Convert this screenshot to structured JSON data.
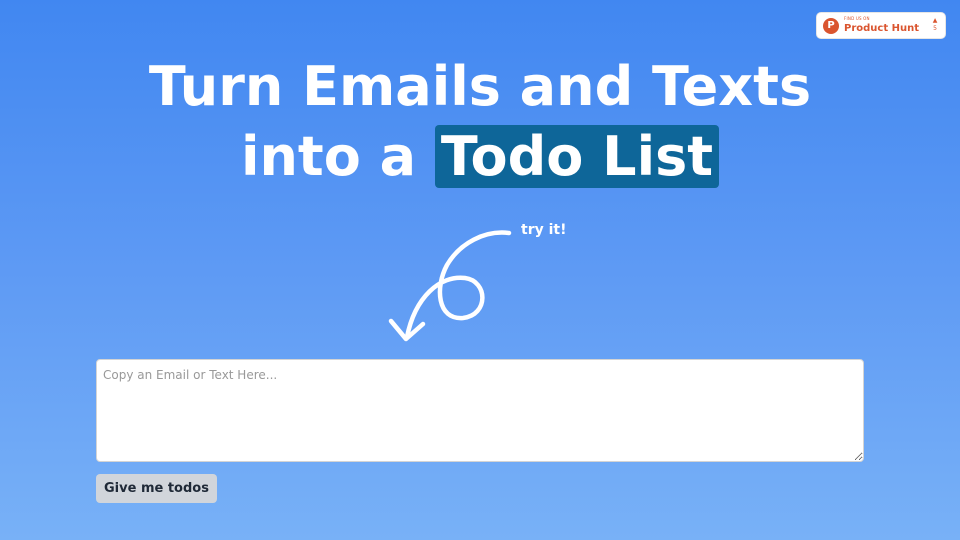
{
  "badge": {
    "logo_letter": "P",
    "small_text": "FIND US ON",
    "name": "Product Hunt",
    "upvote_arrow": "▲",
    "upvote_count": "5"
  },
  "hero": {
    "line1": "Turn Emails and Texts",
    "line2_prefix": "into a ",
    "line2_highlight": "Todo List",
    "highlight_color": "#0e6699"
  },
  "hint": {
    "label": "try it!",
    "icon": "curly-arrow-icon"
  },
  "form": {
    "input_value": "",
    "input_placeholder": "Copy an Email or Text Here...",
    "submit_label": "Give me todos"
  },
  "colors": {
    "background_top": "#4187f1",
    "background_bottom": "#78b1f7",
    "brand": "#da552f"
  }
}
